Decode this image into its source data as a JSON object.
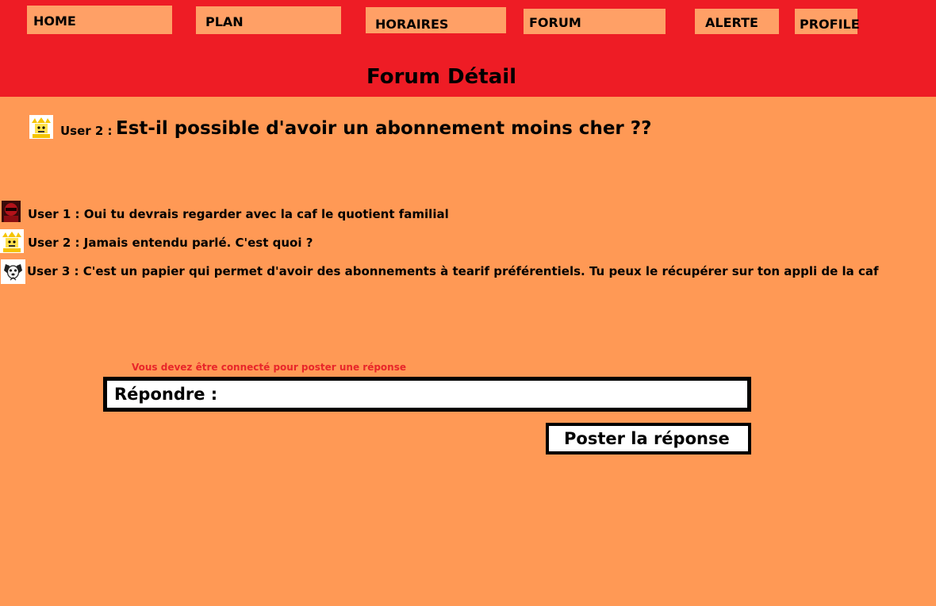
{
  "nav": {
    "home": "HOME",
    "plan": "PLAN",
    "horaires": "HORAIRES",
    "forum": "FORUM",
    "alerte": "ALERTE",
    "profile": "PROFILE"
  },
  "page_title": "Forum Détail",
  "question": {
    "user": "User 2 :",
    "text": "Est-il possible d'avoir un abonnement moins cher ??",
    "avatar_icon": "yellow-character-icon"
  },
  "replies": [
    {
      "text": "User 1 : Oui tu devrais regarder avec la caf le quotient familial",
      "avatar_icon": "red-character-icon"
    },
    {
      "text": "User 2 : Jamais entendu parlé. C'est quoi ?",
      "avatar_icon": "yellow-character-icon"
    },
    {
      "text": "User 3 : C'est un papier qui permet d'avoir des abonnements à tearif préférentiels. Tu peux le récupérer sur ton appli de la caf",
      "avatar_icon": "dog-character-icon"
    }
  ],
  "reply_form": {
    "warning": "Vous devez être connecté  pour poster une réponse",
    "label": "Répondre :",
    "submit_label": "Poster la réponse"
  },
  "colors": {
    "header": "#EE1C25",
    "background": "#FF9955",
    "nav_button": "#FFA066",
    "warning": "#E8262A"
  }
}
